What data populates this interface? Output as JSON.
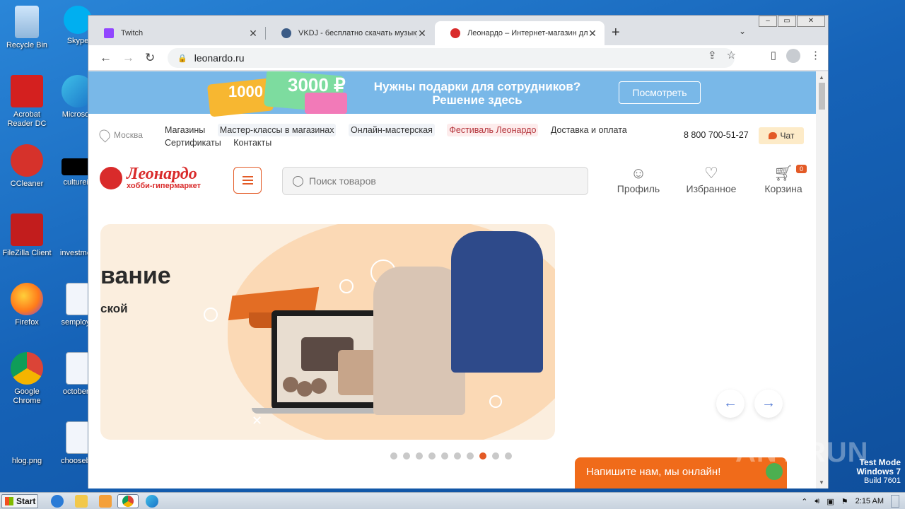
{
  "desktop": {
    "icons": [
      {
        "label": "Recycle Bin",
        "color": "#9ec9f0"
      },
      {
        "label": "Skype",
        "color": "#00aff0"
      },
      {
        "label": "Acrobat Reader DC",
        "color": "#d4201f"
      },
      {
        "label": "Microsoft",
        "color": "#1f8dd6"
      },
      {
        "label": "CCleaner",
        "color": "#d6322b"
      },
      {
        "label": "cultureis",
        "color": "#000000"
      },
      {
        "label": "FileZilla Client",
        "color": "#c21d1d"
      },
      {
        "label": "investmen",
        "color": "#000000"
      },
      {
        "label": "Firefox",
        "color": "#ff7a1a"
      },
      {
        "label": "semploye",
        "color": "#e8eef8"
      },
      {
        "label": "Google Chrome",
        "color": "#4285f4"
      },
      {
        "label": "octoberc",
        "color": "#e8eef8"
      },
      {
        "label": "hlog.png",
        "color": "#1f6fc5"
      },
      {
        "label": "chooseba",
        "color": "#e8eef8"
      }
    ]
  },
  "browser": {
    "tabs": [
      {
        "title": "Twitch",
        "icon": "twitch-icon",
        "color": "#9146ff"
      },
      {
        "title": "VKDJ - бесплатно скачать музыку",
        "icon": "vkdj-icon",
        "color": "#3b5b86"
      },
      {
        "title": "Леонардо – Интернет-магазин для",
        "icon": "leonardo-icon",
        "color": "#d92b2b"
      }
    ],
    "url": "leonardo.ru"
  },
  "site": {
    "promo": {
      "card1": "1000",
      "card2": "3000 ₽",
      "line1": "Нужны подарки для сотрудников?",
      "line2": "Решение здесь",
      "button": "Посмотреть"
    },
    "city": "Москва",
    "nav": {
      "row1": [
        "Магазины",
        "Мастер-классы в магазинах",
        "Онлайн-мастерская",
        "Фестиваль Леонардо",
        "Доставка и оплата"
      ],
      "row2": [
        "Сертификаты",
        "Контакты"
      ]
    },
    "phone": "8 800 700-51-27",
    "chat": "Чат",
    "logo": {
      "name": "Леонардо",
      "sub": "хобби-гипермаркет"
    },
    "search_placeholder": "Поиск товаров",
    "profile": "Профиль",
    "favorites": "Избранное",
    "cart": "Корзина",
    "cart_count": "0",
    "hero": {
      "title": "вание",
      "subtitle": "ской"
    },
    "slides_total": 10,
    "slide_active": 8,
    "livechat": "Напишите нам, мы онлайн!"
  },
  "taskbar": {
    "start": "Start",
    "clock": "2:15 AM"
  },
  "overlay": {
    "watermark": "ANY RUN",
    "testmode_line1": "Test Mode",
    "testmode_line2": "Windows 7",
    "testmode_line3": "Build 7601"
  }
}
